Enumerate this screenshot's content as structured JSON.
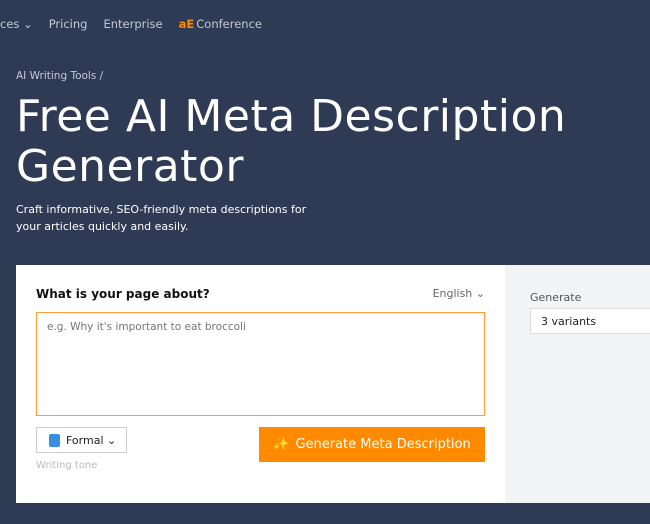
{
  "nav": {
    "items": [
      "ces ⌄",
      "Pricing",
      "Enterprise"
    ],
    "conference_logo": "aE",
    "conference": "Conference"
  },
  "breadcrumb": "AI Writing Tools /",
  "title": "Free AI Meta Description Generator",
  "subtitle": "Craft informative, SEO-friendly meta descriptions for your articles quickly and easily.",
  "form": {
    "question": "What is your page about?",
    "language": "English ⌄",
    "placeholder": "e.g. Why it's important to eat broccoli",
    "tone": "Formal ⌄",
    "tone_label": "Writing tone",
    "generate_button": "Generate Meta Description",
    "sparkle_icon": "✨"
  },
  "options": {
    "generate_label": "Generate",
    "variants": "3 variants"
  },
  "colors": {
    "accent": "#ff8a00",
    "background": "#2f3b54"
  }
}
